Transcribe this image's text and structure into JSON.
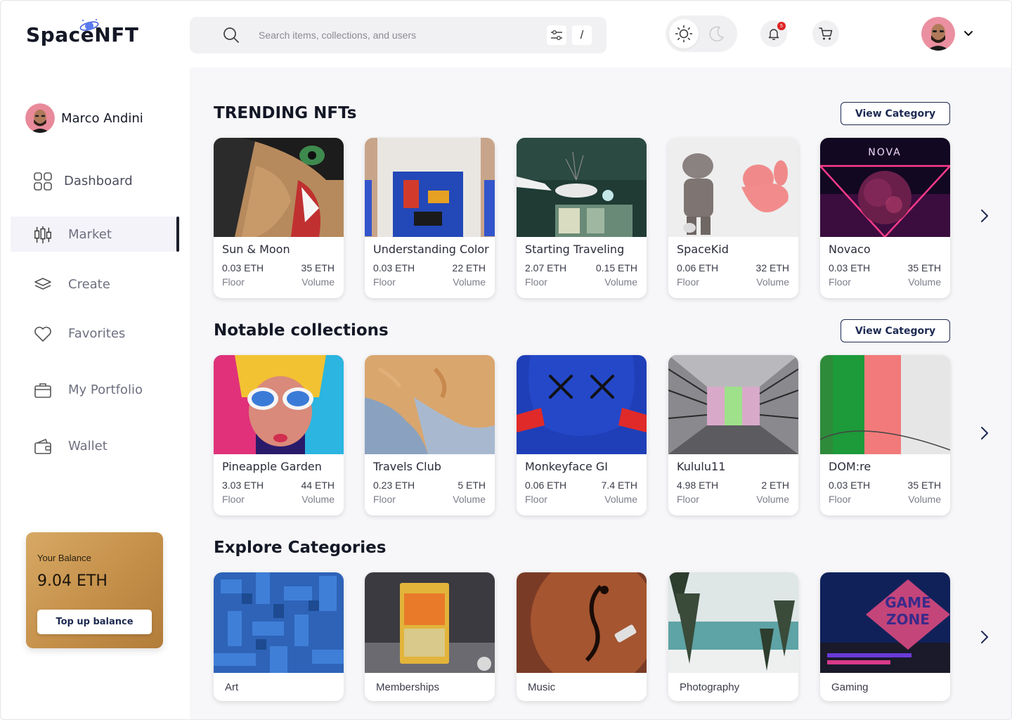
{
  "app": {
    "logo_text": "SpaceNFT"
  },
  "search": {
    "placeholder": "Search items, collections, and users",
    "shortcut": "/"
  },
  "notifications": {
    "count": "5"
  },
  "user": {
    "name": "Marco Andini"
  },
  "sidebar": {
    "items": [
      {
        "label": "Dashboard",
        "icon": "grid-icon"
      },
      {
        "label": "Market",
        "icon": "candlestick-icon",
        "active": true
      },
      {
        "label": "Create",
        "icon": "layers-icon"
      },
      {
        "label": "Favorites",
        "icon": "heart-icon"
      },
      {
        "label": "My Portfolio",
        "icon": "briefcase-icon"
      },
      {
        "label": "Wallet",
        "icon": "wallet-icon"
      }
    ]
  },
  "balance": {
    "label": "Your Balance",
    "value": "9.04 ETH",
    "button": "Top up balance"
  },
  "trending": {
    "title": "TRENDING NFTs",
    "button": "View Category",
    "floor_label": "Floor",
    "volume_label": "Volume",
    "items": [
      {
        "name": "Sun & Moon",
        "floor": "0.03 ETH",
        "volume": "35 ETH"
      },
      {
        "name": "Understanding Color",
        "floor": "0.03 ETH",
        "volume": "22 ETH"
      },
      {
        "name": "Starting Traveling",
        "floor": "2.07 ETH",
        "volume": "0.15 ETH"
      },
      {
        "name": "SpaceKid",
        "floor": "0.06 ETH",
        "volume": "32 ETH"
      },
      {
        "name": "Novaco",
        "floor": "0.03 ETH",
        "volume": "35 ETH",
        "art_text": "NOVA"
      }
    ]
  },
  "notable": {
    "title": "Notable collections",
    "button": "View Category",
    "floor_label": "Floor",
    "volume_label": "Volume",
    "items": [
      {
        "name": "Pineapple Garden",
        "floor": "3.03 ETH",
        "volume": "44 ETH"
      },
      {
        "name": "Travels Club",
        "floor": "0.23 ETH",
        "volume": "5 ETH"
      },
      {
        "name": "Monkeyface GI",
        "floor": "0.06 ETH",
        "volume": "7.4 ETH"
      },
      {
        "name": "Kululu11",
        "floor": "4.98 ETH",
        "volume": "2 ETH"
      },
      {
        "name": "DOM:re",
        "floor": "0.03 ETH",
        "volume": "35 ETH"
      }
    ]
  },
  "categories": {
    "title": "Explore Categories",
    "items": [
      {
        "label": "Art"
      },
      {
        "label": "Memberships"
      },
      {
        "label": "Music"
      },
      {
        "label": "Photography"
      },
      {
        "label": "Gaming",
        "art_text_1": "GAME",
        "art_text_2": "ZONE"
      }
    ]
  },
  "colors": {
    "accent_navy": "#1d2a52",
    "balance_gold": "#c48f49",
    "active_nav_bg": "#f3f3f9",
    "badge_red": "#e02424"
  }
}
